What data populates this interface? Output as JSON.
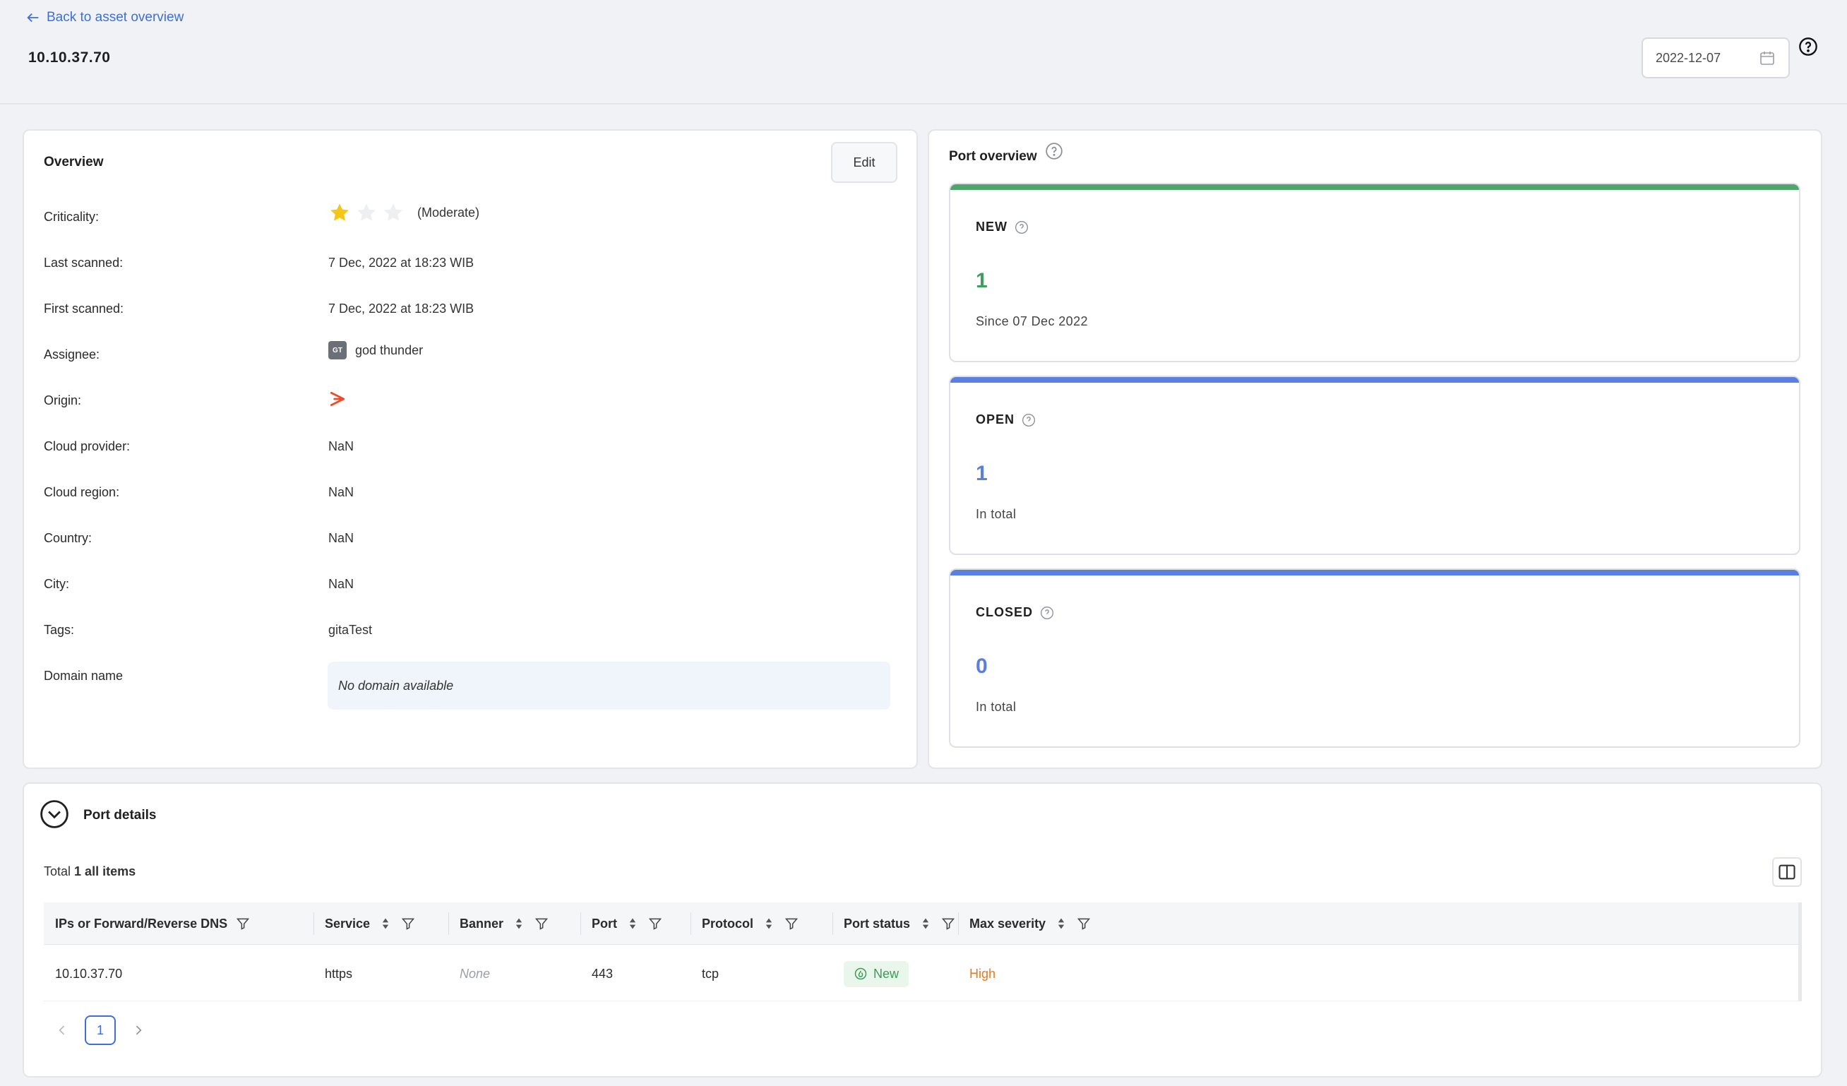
{
  "header": {
    "back_label": "Back to asset overview",
    "title": "10.10.37.70",
    "date_value": "2022-12-07"
  },
  "overview": {
    "title": "Overview",
    "edit_label": "Edit",
    "criticality": {
      "label": "Criticality:",
      "stars_filled": 1,
      "stars_total": 3,
      "text": "(Moderate)"
    },
    "last_scanned": {
      "label": "Last scanned:",
      "value": "7 Dec, 2022 at 18:23 WIB"
    },
    "first_scanned": {
      "label": "First scanned:",
      "value": "7 Dec, 2022 at 18:23 WIB"
    },
    "assignee": {
      "label": "Assignee:",
      "initials": "GT",
      "value": "god thunder"
    },
    "origin": {
      "label": "Origin:",
      "icon": "origin-logo-icon"
    },
    "cloud_provider": {
      "label": "Cloud provider:",
      "value": "NaN"
    },
    "cloud_region": {
      "label": "Cloud region:",
      "value": "NaN"
    },
    "country": {
      "label": "Country:",
      "value": "NaN"
    },
    "city": {
      "label": "City:",
      "value": "NaN"
    },
    "tags": {
      "label": "Tags:",
      "value": "gitaTest"
    },
    "domain": {
      "label": "Domain name",
      "value": "No domain available"
    }
  },
  "port_overview": {
    "title": "Port overview",
    "new": {
      "label": "NEW",
      "count": "1",
      "sub": "Since 07 Dec 2022",
      "color": "#3f9e5e"
    },
    "open": {
      "label": "OPEN",
      "count": "1",
      "sub": "In total",
      "color": "#5b7fe0"
    },
    "closed": {
      "label": "CLOSED",
      "count": "0",
      "sub": "In total",
      "color": "#5b7fe0"
    }
  },
  "port_details": {
    "title": "Port details",
    "total_prefix": "Total",
    "total_count": "1 all items",
    "columns": [
      "IPs or Forward/Reverse DNS",
      "Service",
      "Banner",
      "Port",
      "Protocol",
      "Port status",
      "Max severity"
    ],
    "rows": [
      {
        "ip": "10.10.37.70",
        "service": "https",
        "banner": "None",
        "port": "443",
        "protocol": "tcp",
        "status": "New",
        "severity": "High"
      }
    ],
    "severity_color": "#e07b22",
    "current_page": "1"
  }
}
